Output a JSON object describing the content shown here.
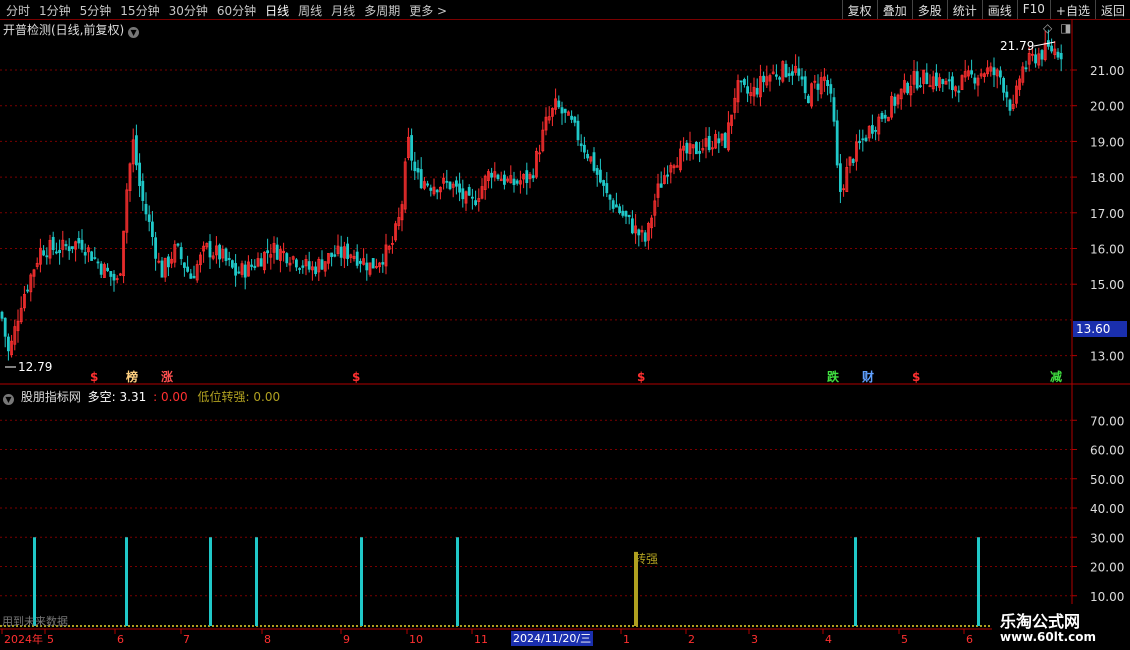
{
  "toolbar": {
    "periods": [
      "分时",
      "1分钟",
      "5分钟",
      "15分钟",
      "30分钟",
      "60分钟",
      "日线",
      "周线",
      "月线",
      "多周期",
      "更多 >"
    ],
    "active_period": "日线",
    "right_buttons": [
      "复权",
      "叠加",
      "多股",
      "统计",
      "画线",
      "F10",
      "+自选",
      "返回"
    ]
  },
  "main_pane": {
    "title": "开普检测(日线,前复权)",
    "high_label": "21.79",
    "low_label": "12.79",
    "current_price": "13.60",
    "y_ticks": [
      "21.00",
      "20.00",
      "19.00",
      "18.00",
      "17.00",
      "16.00",
      "15.00",
      "13.00"
    ],
    "markers": [
      {
        "text": "$",
        "color": "#ff3030"
      },
      {
        "text": "榜",
        "color": "#ffd080"
      },
      {
        "text": "涨",
        "color": "#ff5050"
      },
      {
        "text": "$",
        "color": "#ff3030"
      },
      {
        "text": "$",
        "color": "#ff3030"
      },
      {
        "text": "跌",
        "color": "#40e040"
      },
      {
        "text": "财",
        "color": "#60a0ff"
      },
      {
        "text": "$",
        "color": "#ff3030"
      },
      {
        "text": "减",
        "color": "#40e040"
      }
    ]
  },
  "indicator_pane": {
    "name": "股朋指标网",
    "duo_kong_label": "多空:",
    "duo_kong_value": "3.31",
    "sep": ":",
    "second_value": "0.00",
    "low_to_strong_label": "低位转强:",
    "low_to_strong_value": "0.00",
    "signal_label": "转强",
    "y_ticks": [
      "70.00",
      "60.00",
      "50.00",
      "40.00",
      "30.00",
      "20.00",
      "10.00"
    ],
    "future_data_note": "用到未来数据",
    "colors": {
      "bar": "#20c8c8",
      "signal": "#b0a020",
      "duokong": "#ffffff",
      "red": "#ff3030",
      "yellow": "#b0a020"
    }
  },
  "x_axis": {
    "labels": [
      "2024年",
      "5",
      "6",
      "7",
      "8",
      "9",
      "10",
      "11",
      "2024/11/20/三",
      "1",
      "2",
      "3",
      "4",
      "5",
      "6"
    ],
    "selected_date": "2024/11/20/三"
  },
  "watermark": {
    "line1": "乐淘公式网",
    "line2": "www.60lt.com"
  },
  "chart_data": {
    "type": "candlestick",
    "title": "开普检测(日线,前复权)",
    "ylim": [
      12.5,
      22.0
    ],
    "y_ticks": [
      13,
      15,
      16,
      17,
      18,
      19,
      20,
      21
    ],
    "high": 21.79,
    "low": 12.79,
    "last": 13.6,
    "close_path": [
      [
        0,
        14.2
      ],
      [
        8,
        13.0
      ],
      [
        20,
        14.5
      ],
      [
        40,
        16.0
      ],
      [
        60,
        16.0
      ],
      [
        80,
        16.2
      ],
      [
        100,
        15.5
      ],
      [
        118,
        15.0
      ],
      [
        125,
        17.5
      ],
      [
        132,
        19.0
      ],
      [
        140,
        17.5
      ],
      [
        150,
        16.5
      ],
      [
        160,
        15.3
      ],
      [
        175,
        16.0
      ],
      [
        190,
        15.2
      ],
      [
        205,
        16.0
      ],
      [
        220,
        15.8
      ],
      [
        235,
        15.3
      ],
      [
        250,
        15.5
      ],
      [
        270,
        16.0
      ],
      [
        290,
        15.8
      ],
      [
        310,
        15.4
      ],
      [
        330,
        15.8
      ],
      [
        350,
        15.9
      ],
      [
        370,
        15.5
      ],
      [
        390,
        16.0
      ],
      [
        400,
        17.0
      ],
      [
        407,
        19.0
      ],
      [
        415,
        18.0
      ],
      [
        430,
        17.8
      ],
      [
        450,
        17.8
      ],
      [
        470,
        17.2
      ],
      [
        490,
        18.2
      ],
      [
        510,
        17.8
      ],
      [
        530,
        18.0
      ],
      [
        545,
        19.5
      ],
      [
        555,
        20.0
      ],
      [
        570,
        19.5
      ],
      [
        590,
        18.5
      ],
      [
        605,
        17.5
      ],
      [
        620,
        17.0
      ],
      [
        635,
        16.5
      ],
      [
        645,
        16.2
      ],
      [
        655,
        17.5
      ],
      [
        670,
        18.5
      ],
      [
        690,
        18.7
      ],
      [
        710,
        19.0
      ],
      [
        725,
        19.0
      ],
      [
        735,
        20.5
      ],
      [
        750,
        20.3
      ],
      [
        765,
        20.8
      ],
      [
        780,
        21.0
      ],
      [
        795,
        21.0
      ],
      [
        805,
        20.2
      ],
      [
        815,
        20.6
      ],
      [
        825,
        20.8
      ],
      [
        832,
        19.8
      ],
      [
        838,
        17.5
      ],
      [
        850,
        18.5
      ],
      [
        870,
        19.4
      ],
      [
        890,
        20.0
      ],
      [
        910,
        20.7
      ],
      [
        930,
        20.8
      ],
      [
        950,
        20.5
      ],
      [
        970,
        20.8
      ],
      [
        985,
        21.0
      ],
      [
        1000,
        20.8
      ],
      [
        1012,
        19.8
      ],
      [
        1020,
        21.0
      ],
      [
        1035,
        21.4
      ],
      [
        1050,
        21.6
      ],
      [
        1060,
        21.5
      ]
    ]
  },
  "indicator_data": {
    "type": "bar",
    "ylim": [
      0,
      80
    ],
    "bars_value": 30,
    "signal_value": 25
  }
}
